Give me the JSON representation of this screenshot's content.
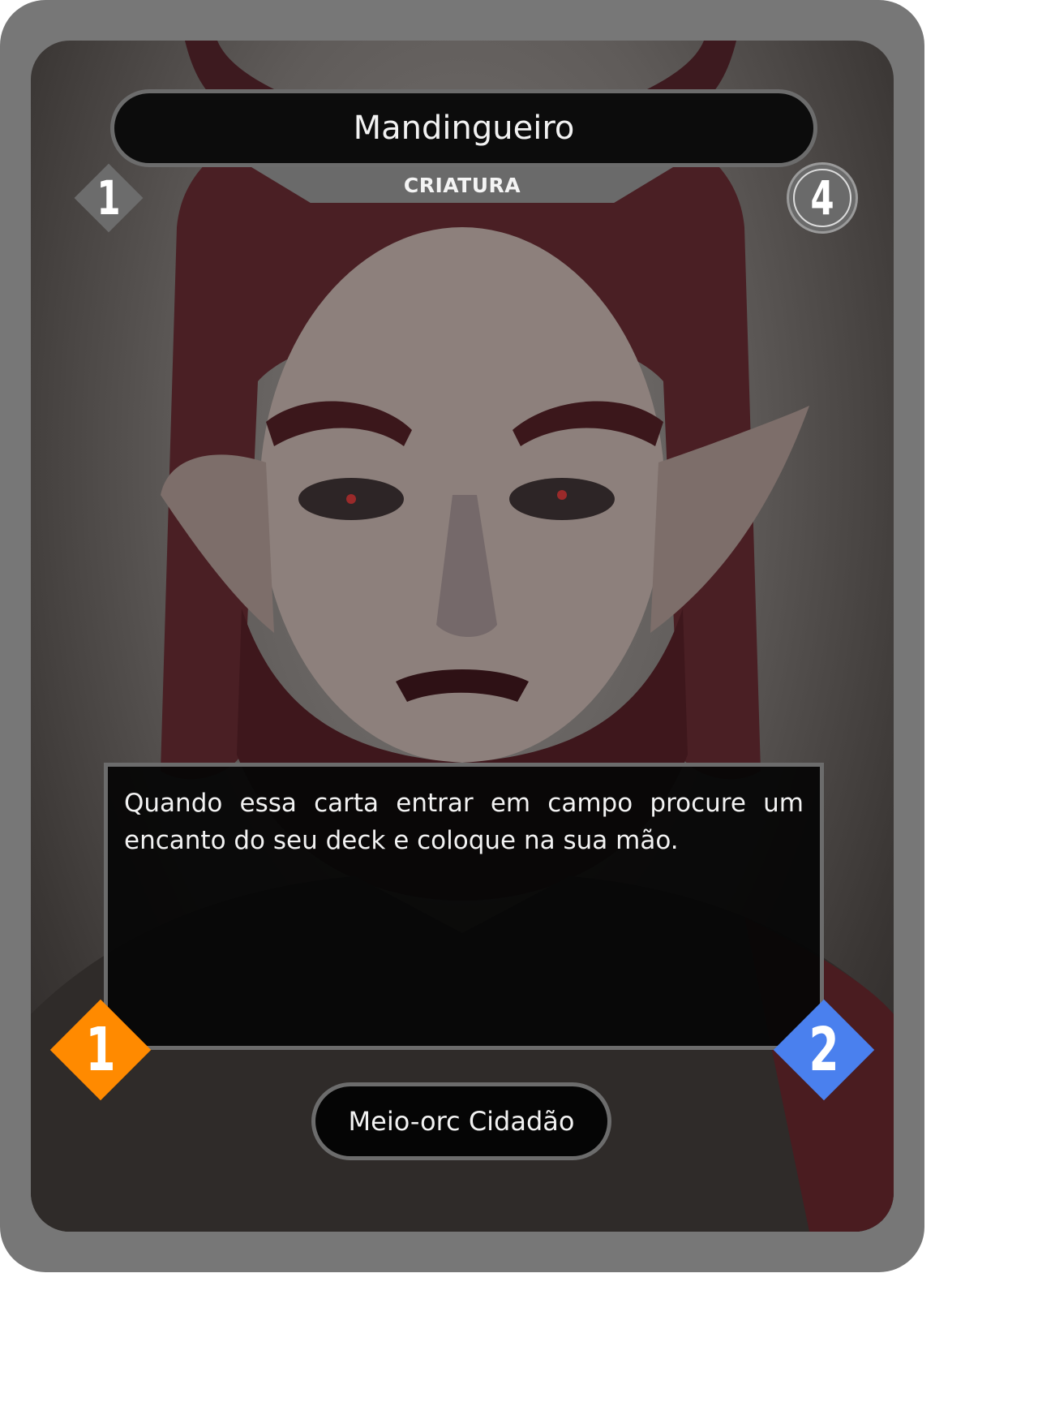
{
  "card": {
    "name": "Mandingueiro",
    "type": "CRIATURA",
    "cost": "1",
    "circle_value": "4",
    "effect_text": "Quando essa carta entrar em campo procure um encanto do seu deck e coloque na sua mão.",
    "attack": "1",
    "defense": "2",
    "race": "Meio-orc Cidadão"
  },
  "colors": {
    "frame": "#777777",
    "panel": "#0c0c0c",
    "panel_border": "#6c6c6c",
    "attack_gem": "#ff8a00",
    "defense_gem": "#4a80ee"
  },
  "icons": {
    "cost": "gray-diamond",
    "circle_stat": "gray-circle",
    "attack": "orange-diamond",
    "defense": "blue-diamond"
  }
}
